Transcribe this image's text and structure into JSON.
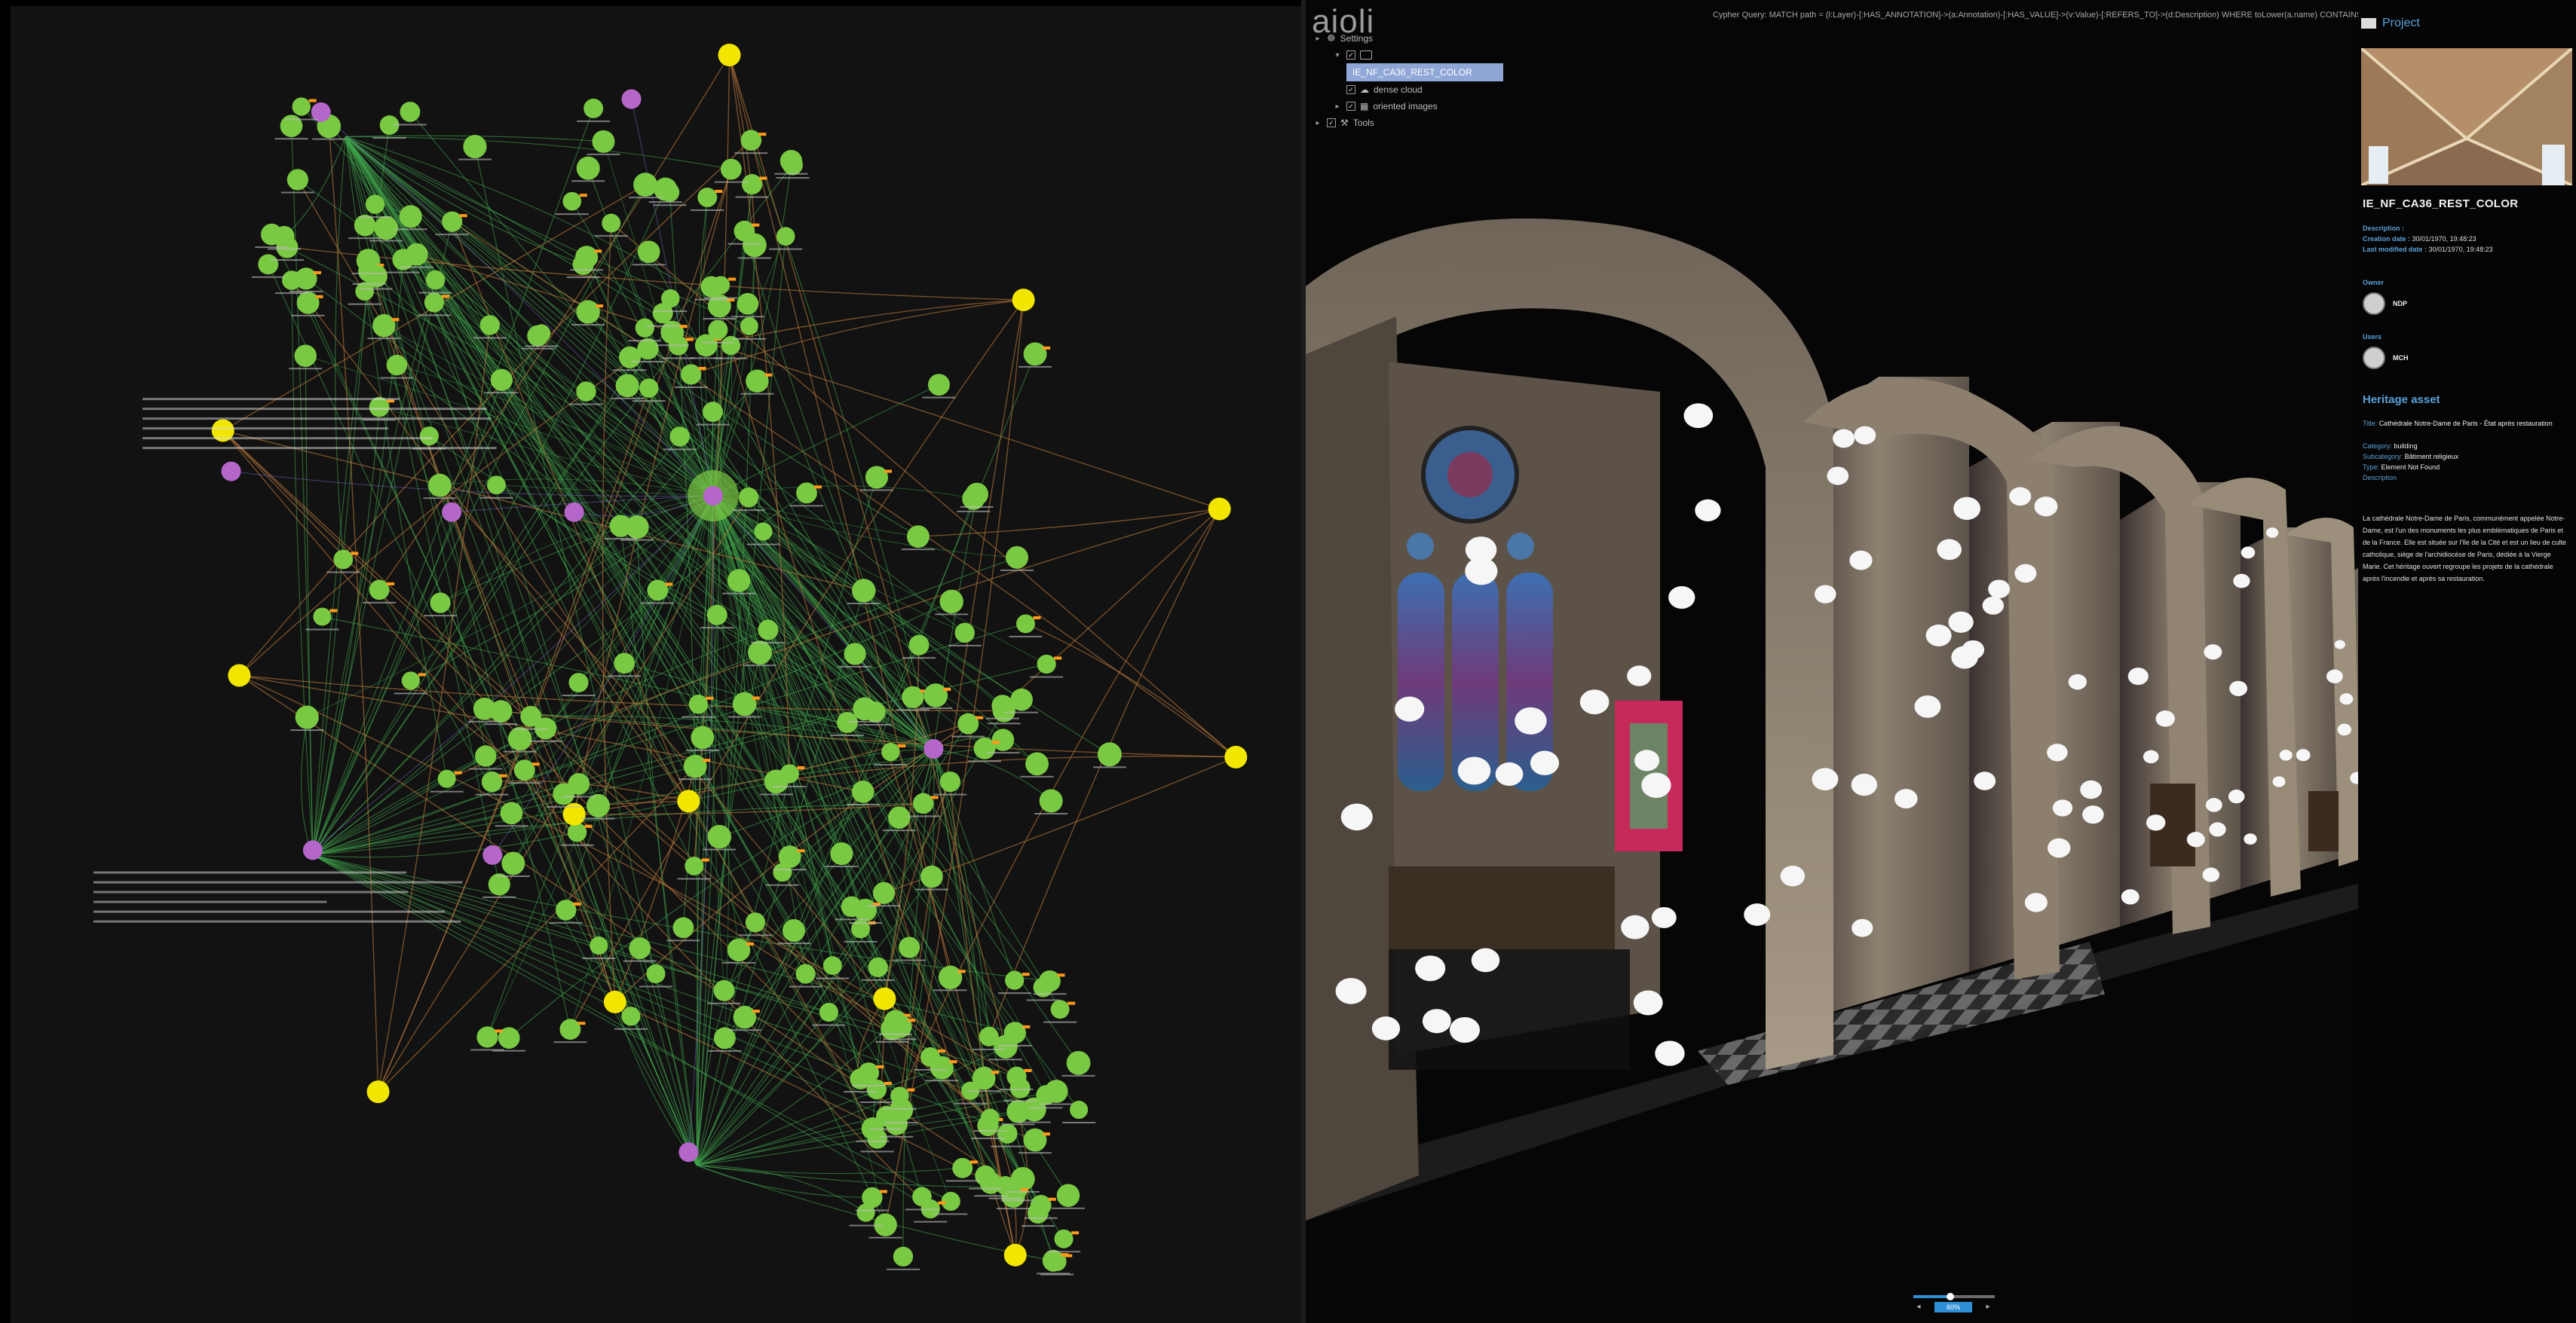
{
  "colors": {
    "annotation_node": "#7ac943",
    "layer_node": "#f2e600",
    "description_node": "#b566c9",
    "edge_annotation": "#3fa44a",
    "edge_layer": "#b8763b",
    "accent_blue": "#5aa0d8",
    "selection": "#8fa7d6"
  },
  "graph": {
    "node_types": [
      "Annotation",
      "Layer",
      "Description"
    ]
  },
  "viewer": {
    "logo": "aioli",
    "cypher_query": "Cypher Query: MATCH path = (l:Layer)-[:HAS_ANNOTATION]->(a:Annotation)-[:HAS_VALUE]->(v:Value)-[:REFERS_TO]->(d:Description) WHERE toLower(a.name) CONTAINS 'affiche' RETURN path",
    "layer_tree": {
      "settings_label": "Settings",
      "selected_label": "IE_NF_CA36_REST_COLOR",
      "dense_cloud_label": "dense cloud",
      "oriented_images_label": "oriented images",
      "tools_label": "Tools"
    },
    "slider": {
      "value": 0.45,
      "label": "60%"
    }
  },
  "info_panel": {
    "project_label": "Project",
    "asset_title": "IE_NF_CA36_REST_COLOR",
    "description_label": "Description :",
    "creation_date_label": "Creation date :",
    "creation_date": "30/01/1970, 19:48:23",
    "last_modified_label": "Last modified date :",
    "last_modified": "30/01/1970, 19:48:23",
    "owner_label": "Owner",
    "owner_name": "NDP",
    "users_label": "Users",
    "user_name": "MCH",
    "heritage_title": "Heritage asset",
    "title_key": "Title:",
    "title_value": "Cathédrale Notre-Dame de Paris - État après restauration",
    "category_key": "Category:",
    "category_value": "building",
    "subcategory_key": "Subcategory:",
    "subcategory_value": "Bâtiment religieux",
    "type_key": "Type:",
    "type_value": "Element Not Found",
    "description_key": "Description",
    "description_text": "La cathédrale Notre-Dame de Paris, communément appelée Notre-Dame, est l'un des monuments les plus emblématiques de Paris et de la France. Elle est située sur l'île de la Cité et est un lieu de culte catholique, siège de l'archidiocèse de Paris, dédiée à la Vierge Marie. Cet héritage ouvert regroupe les projets de la cathédrale après l'incendie et après sa restauration."
  }
}
